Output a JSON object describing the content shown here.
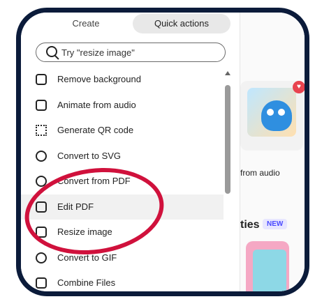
{
  "tabs": {
    "create": "Create",
    "quick_actions": "Quick actions"
  },
  "search": {
    "placeholder": "Try \"resize image\""
  },
  "actions": [
    {
      "label": "Remove background",
      "icon": "image-remove-icon"
    },
    {
      "label": "Animate from audio",
      "icon": "animate-audio-icon"
    },
    {
      "label": "Generate QR code",
      "icon": "qr-code-icon"
    },
    {
      "label": "Convert to SVG",
      "icon": "convert-svg-icon"
    },
    {
      "label": "Convert from PDF",
      "icon": "convert-pdf-icon"
    },
    {
      "label": "Edit PDF",
      "icon": "edit-pdf-icon"
    },
    {
      "label": "Resize image",
      "icon": "resize-image-icon"
    },
    {
      "label": "Convert to GIF",
      "icon": "convert-gif-icon"
    },
    {
      "label": "Combine Files",
      "icon": "combine-files-icon"
    }
  ],
  "right": {
    "card_label": "from audio",
    "section_title": "ties",
    "new_badge": "NEW"
  },
  "colors": {
    "frame": "#0b1b3a",
    "annotation": "#d0113c",
    "badge_text": "#4a4aff"
  }
}
